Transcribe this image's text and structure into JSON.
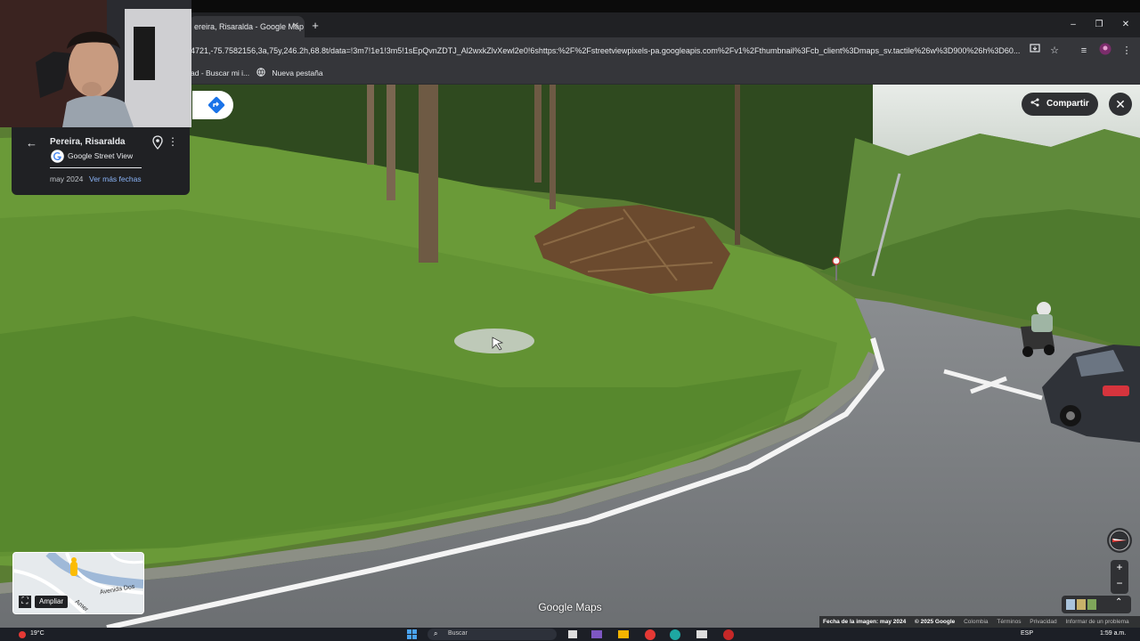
{
  "browser": {
    "tab_title": "ereira, Risaralda - Google Map",
    "tab_close": "✕",
    "new_tab": "+",
    "url": "4721,-75.7582156,3a,75y,246.2h,68.8t/data=!3m7!1e1!3m5!1sEpQvnZDTJ_Al2wxkZlvXewl2e0!6shttps:%2F%2Fstreetviewpixels-pa.googleapis.com%2Fv1%2Fthumbnail%3Fcb_client%3Dmaps_sv.tactile%26w%3D900%26h%3D60...",
    "window_buttons": [
      "–",
      "❐",
      "✕"
    ],
    "bookmarks": [
      {
        "label": "ad - Buscar mi i..."
      },
      {
        "label": "Nueva pestaña"
      }
    ]
  },
  "place": {
    "name": "Pereira, Risaralda",
    "source": "Google Street View",
    "date": "may 2024",
    "more_dates": "Ver más fechas"
  },
  "actions": {
    "share": "Compartir",
    "close": "✕"
  },
  "minimap": {
    "street_label": "Avenida Dos",
    "street_label2": "Amer",
    "expand_label": "Ampliar"
  },
  "controls": {
    "zoom_in": "+",
    "zoom_out": "−",
    "expand": "⌃"
  },
  "watermark": "Google Maps",
  "footer": {
    "capture_date": "Fecha de la imagen: may 2024",
    "copyright": "© 2025 Google",
    "country": "Colombia",
    "terms": "Términos",
    "privacy": "Privacidad",
    "report": "Informar de un problema"
  },
  "taskbar": {
    "weather": "19°C",
    "search_placeholder": "Buscar",
    "language": "ESP",
    "time": "1:59 a.m."
  },
  "colors": {
    "chrome_dark": "#202124",
    "chrome_mid": "#35363a",
    "grass": "#5f8c32",
    "road": "#7c7f82",
    "accent_blue": "#8ab4f8"
  }
}
